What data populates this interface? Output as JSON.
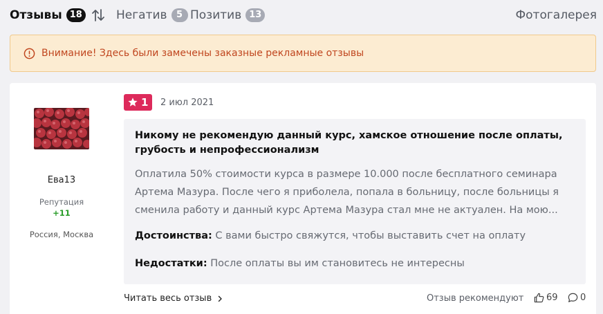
{
  "tabs": [
    {
      "label": "Отзывы",
      "count": "18",
      "active": true
    },
    {
      "label": "Негатив",
      "count": "5",
      "active": false
    },
    {
      "label": "Позитив",
      "count": "13",
      "active": false
    }
  ],
  "gallery_label": "Фотогалерея",
  "warning": {
    "text": "Внимание! Здесь были замечены заказные рекламные отзывы"
  },
  "review": {
    "user": {
      "name": "Ева13",
      "reputation_label": "Репутация",
      "reputation_value": "+11",
      "location": "Россия, Москва"
    },
    "rating": "1",
    "date": "2 июл 2021",
    "title": "Никому не рекомендую данный курс, хамское отношение после оплаты, грубость и непрофессионализм",
    "text": "Оплатила 50% стоимости курса в размере 10.000 после бесплатного семинара Артема Мазура. После чего я приболела, попала в больницу, после больницы я сменила работу и данный курс Артема Мазура стал мне не актуален. На мою...",
    "pros_label": "Достоинства:",
    "pros": "С вами быстро свяжутся, чтобы выставить счет на оплату",
    "cons_label": "Недостатки:",
    "cons": "После оплаты вы им становитесь не интересны",
    "read_more": "Читать весь отзыв",
    "recommend_label": "Отзыв рекомендуют",
    "likes": "69",
    "comments": "0"
  },
  "colors": {
    "rating_badge": "#dd2a5b",
    "warning_bg": "#fcecd2",
    "warning_text": "#c0461f",
    "reputation": "#2a9d2a"
  }
}
